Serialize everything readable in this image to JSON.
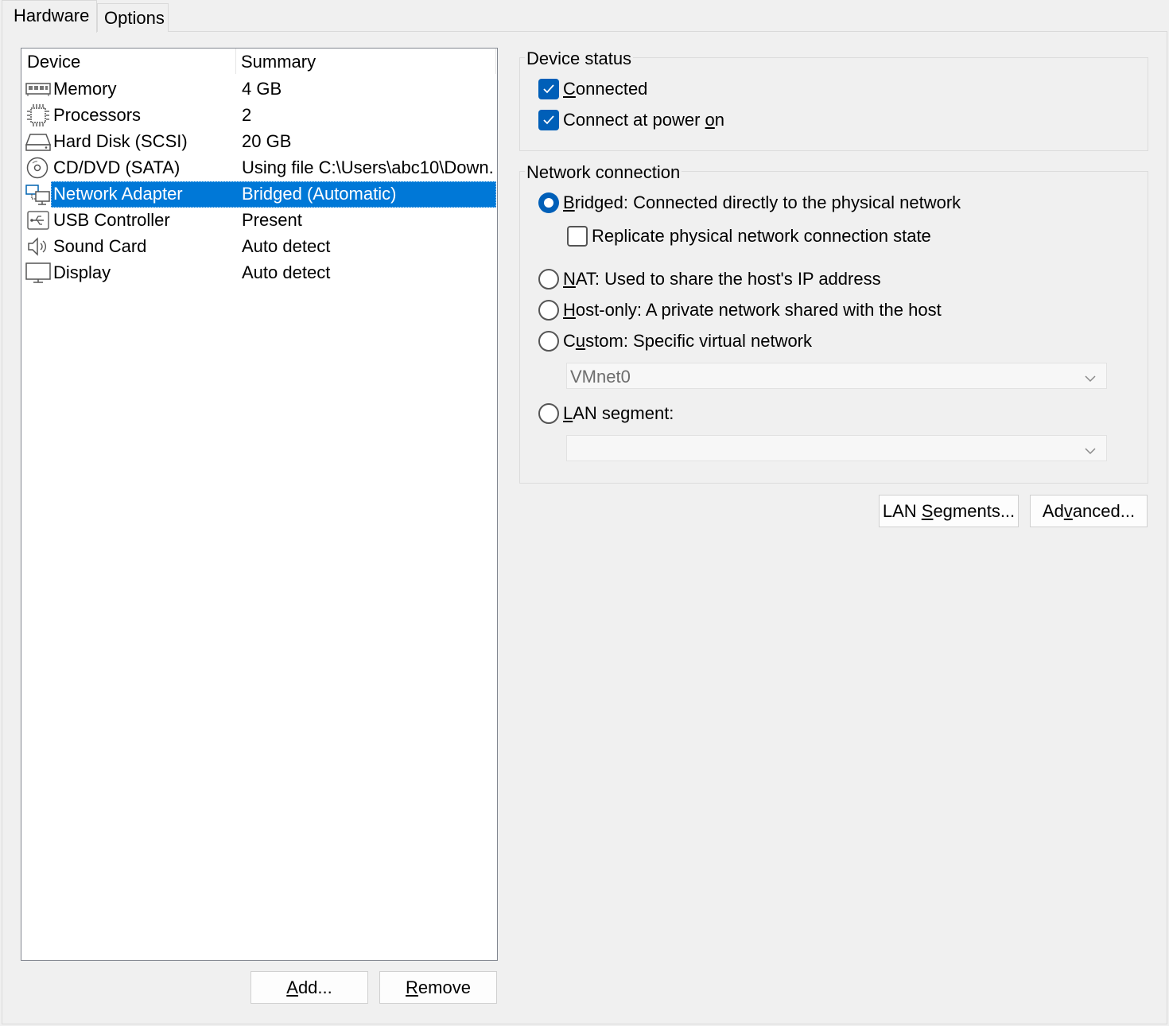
{
  "tabs": {
    "hardware": "Hardware",
    "options": "Options"
  },
  "device_list": {
    "headers": {
      "device": "Device",
      "summary": "Summary"
    },
    "rows": [
      {
        "name": "Memory",
        "summary": "4 GB",
        "icon": "memory-icon"
      },
      {
        "name": "Processors",
        "summary": "2",
        "icon": "processor-icon"
      },
      {
        "name": "Hard Disk (SCSI)",
        "summary": "20 GB",
        "icon": "hard-disk-icon"
      },
      {
        "name": "CD/DVD (SATA)",
        "summary": "Using file C:\\Users\\abc10\\Down...",
        "icon": "cd-dvd-icon"
      },
      {
        "name": "Network Adapter",
        "summary": "Bridged (Automatic)",
        "icon": "network-adapter-icon",
        "selected": true
      },
      {
        "name": "USB Controller",
        "summary": "Present",
        "icon": "usb-icon"
      },
      {
        "name": "Sound Card",
        "summary": "Auto detect",
        "icon": "speaker-icon"
      },
      {
        "name": "Display",
        "summary": "Auto detect",
        "icon": "monitor-icon"
      }
    ]
  },
  "buttons": {
    "add": {
      "pre": "",
      "u": "A",
      "post": "dd..."
    },
    "remove": {
      "pre": "",
      "u": "R",
      "post": "emove"
    },
    "lan_segments": {
      "pre": "LAN ",
      "u": "S",
      "post": "egments..."
    },
    "advanced": {
      "pre": "Ad",
      "u": "v",
      "post": "anced..."
    }
  },
  "device_status": {
    "title": "Device status",
    "connected": {
      "pre": "",
      "u": "C",
      "post": "onnected",
      "checked": true
    },
    "connect_power_on": {
      "pre": "Connect at power ",
      "u": "o",
      "post": "n",
      "checked": true
    }
  },
  "network_connection": {
    "title": "Network connection",
    "bridged": {
      "pre": "",
      "u": "B",
      "post": "ridged: Connected directly to the physical network",
      "selected": true
    },
    "replicate": {
      "text": "Replicate physical network connection state",
      "checked": false
    },
    "nat": {
      "pre": "",
      "u": "N",
      "post": "AT: Used to share the host's IP address",
      "selected": false
    },
    "host_only": {
      "pre": "",
      "u": "H",
      "post": "ost-only: A private network shared with the host",
      "selected": false
    },
    "custom": {
      "pre": "C",
      "u": "u",
      "post": "stom: Specific virtual network",
      "selected": false
    },
    "custom_select_value": "VMnet0",
    "lan_segment": {
      "pre": "",
      "u": "L",
      "post": "AN segment:",
      "selected": false
    },
    "lan_select_value": ""
  },
  "colors": {
    "accent": "#005fb8",
    "selection": "#0078d7",
    "background": "#f0f0f0"
  }
}
